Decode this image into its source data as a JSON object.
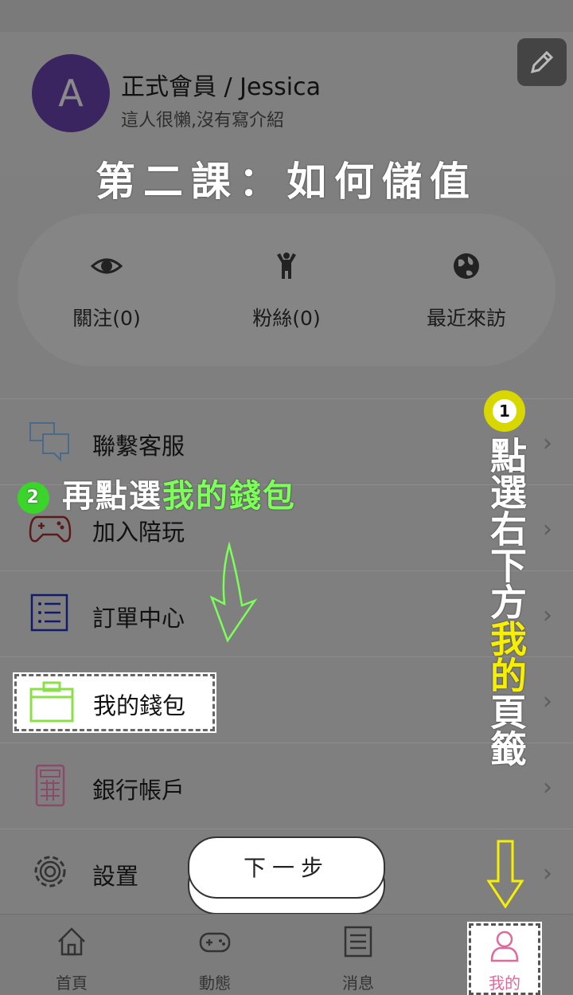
{
  "profile": {
    "avatar_letter": "A",
    "name": "正式會員 / Jessica",
    "bio": "這人很懶,沒有寫介紹"
  },
  "lesson_title": "第二課：如何儲值",
  "stats": [
    {
      "label": "關注(0)",
      "icon": "eye-icon"
    },
    {
      "label": "粉絲(0)",
      "icon": "person-icon"
    },
    {
      "label": "最近來訪",
      "icon": "globe-icon"
    }
  ],
  "menu": [
    {
      "label": "聯繫客服",
      "icon": "chat-icon"
    },
    {
      "label": "加入陪玩",
      "icon": "gamepad-icon"
    },
    {
      "label": "訂單中心",
      "icon": "list-icon"
    },
    {
      "label": "我的錢包",
      "icon": "wallet-icon"
    },
    {
      "label": "銀行帳戶",
      "icon": "calculator-icon"
    },
    {
      "label": "設置",
      "icon": "gear-icon"
    }
  ],
  "annotations": {
    "step1_num": "1",
    "step1_text_a": "點選右下方",
    "step1_text_b": "我的",
    "step1_text_c": "頁籤",
    "step2_num": "2",
    "step2_text_a": "再點選",
    "step2_text_b": "我的錢包",
    "next_label": "下一步"
  },
  "tabs": [
    {
      "label": "首頁",
      "icon": "home-icon"
    },
    {
      "label": "動態",
      "icon": "controller-icon"
    },
    {
      "label": "消息",
      "icon": "message-list-icon"
    },
    {
      "label": "我的",
      "icon": "user-icon"
    }
  ],
  "colors": {
    "overlay": "#7f7f7f",
    "avatar": "#3b2560",
    "highlight_green": "#7dff5a",
    "highlight_yellow": "#f6f000",
    "active_tab": "#e06a9a"
  }
}
